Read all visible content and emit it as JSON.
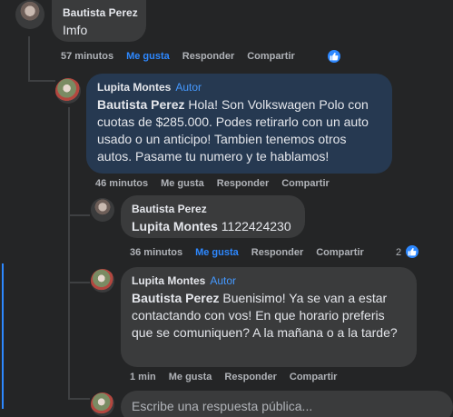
{
  "comments": [
    {
      "author": "Bautista Perez",
      "text": "Imfo",
      "time": "57 minutos",
      "like_label": "Me gusta",
      "reply_label": "Responder",
      "share_label": "Compartir"
    },
    {
      "author": "Lupita Montes",
      "author_badge": "Autor",
      "mention": "Bautista Perez",
      "text": " Hola! Son Volkswagen Polo con cuotas de $285.000. Podes retirarlo con un auto usado o un anticipo! Tambien tenemos otros autos. Pasame tu numero y te hablamos!",
      "time": "46 minutos",
      "like_label": "Me gusta",
      "reply_label": "Responder",
      "share_label": "Compartir"
    },
    {
      "author": "Bautista Perez",
      "mention": "Lupita Montes",
      "text": " 1122424230",
      "time": "36 minutos",
      "like_label": "Me gusta",
      "reply_label": "Responder",
      "share_label": "Compartir",
      "reaction_count": "2"
    },
    {
      "author": "Lupita Montes",
      "author_badge": "Autor",
      "mention": "Bautista Perez",
      "text": " Buenisimo! Ya se van a estar contactando con vos! En que horario preferis que se comuniquen? A la mañana o a la tarde?",
      "time": "1 min",
      "like_label": "Me gusta",
      "reply_label": "Responder",
      "share_label": "Compartir"
    }
  ],
  "reply_box": {
    "placeholder": "Escribe una respuesta pública..."
  },
  "colors": {
    "accent": "#2d88ff",
    "background": "#242526",
    "bubble": "#3a3b3c",
    "highlight_bubble": "#263951"
  }
}
